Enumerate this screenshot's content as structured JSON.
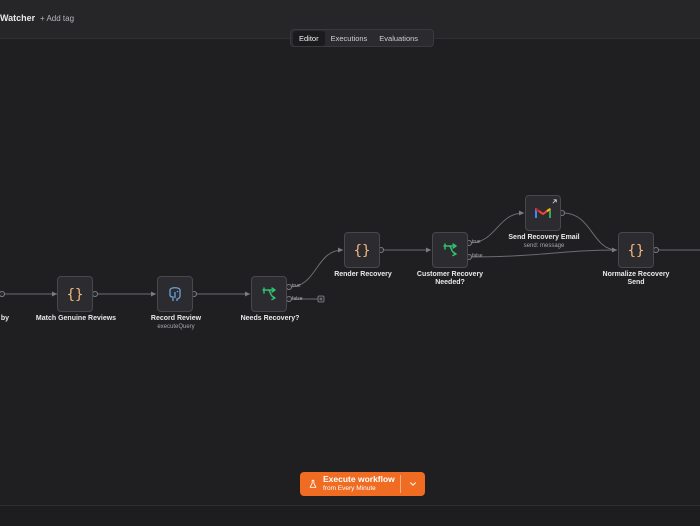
{
  "header": {
    "title": "Watcher",
    "add_tag": "+ Add tag"
  },
  "tabs": [
    {
      "label": "Editor",
      "active": true
    },
    {
      "label": "Executions",
      "active": false
    },
    {
      "label": "Evaluations",
      "active": false
    }
  ],
  "nodes": {
    "partial": {
      "label": "by"
    },
    "match_genuine": {
      "label": "Match Genuine Reviews",
      "icon": "code-braces-icon"
    },
    "record_review": {
      "label": "Record Review",
      "sub": "executeQuery",
      "icon": "postgres-elephant-icon"
    },
    "needs_recovery": {
      "label": "Needs Recovery?",
      "icon": "if-branch-icon"
    },
    "render_recovery": {
      "label": "Render Recovery",
      "icon": "code-braces-icon"
    },
    "customer_recovery": {
      "label": "Customer Recovery Needed?",
      "icon": "if-branch-icon"
    },
    "send_recovery_email": {
      "label": "Send Recovery Email",
      "sub": "send: message",
      "icon": "gmail-icon"
    },
    "normalize_recovery": {
      "label": "Normalize Recovery Send",
      "icon": "code-braces-icon"
    }
  },
  "ports": {
    "true_label": "true",
    "false_label": "false"
  },
  "execute": {
    "label": "Execute workflow",
    "sub": "from Every Minute"
  },
  "colors": {
    "accent": "#ef6c22",
    "braces": "#f2b880",
    "if_green": "#2fbf71"
  }
}
